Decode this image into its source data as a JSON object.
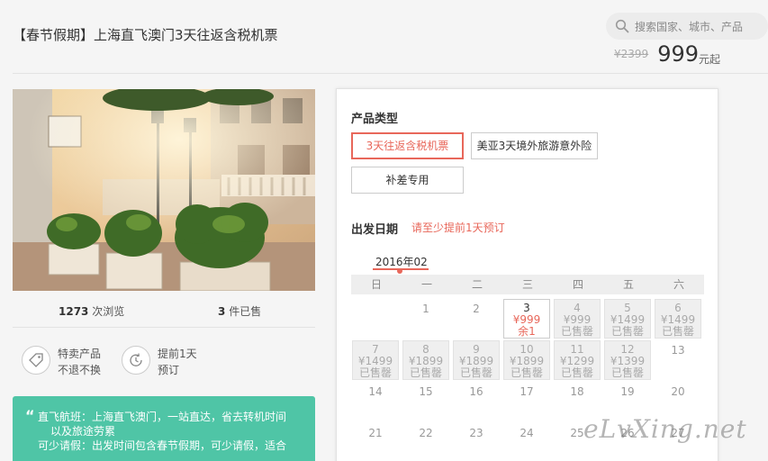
{
  "header": {
    "title": "【春节假期】上海直飞澳门3天往返含税机票",
    "search_placeholder": "搜索国家、城市、产品",
    "old_price": "¥2399",
    "price": "999",
    "price_unit": "元起"
  },
  "stats": {
    "views": "1273",
    "views_label": "次浏览",
    "sold": "3",
    "sold_label": "件已售"
  },
  "features": [
    {
      "icon": "tag-icon",
      "line1": "特卖产品",
      "line2": "不退不换"
    },
    {
      "icon": "clock-icon",
      "line1": "提前1天",
      "line2": "预订"
    }
  ],
  "promo": {
    "line1": "直飞航班：上海直飞澳门，一站直达，省去转机时间",
    "line2": "以及旅途劳累",
    "line3": "可少请假：出发时间包含春节假期，可少请假，适合"
  },
  "booking": {
    "product_type_label": "产品类型",
    "options": [
      "3天往返含税机票",
      "美亚3天境外旅游意外险",
      "补差专用"
    ],
    "date_label": "出发日期",
    "date_note": "请至少提前1天预订",
    "month": "2016年02",
    "weekdays": [
      "日",
      "一",
      "二",
      "三",
      "四",
      "五",
      "六"
    ],
    "days": [
      {
        "day": "1",
        "state": "plain"
      },
      {
        "day": "2",
        "state": "plain"
      },
      {
        "day": "3",
        "state": "avail",
        "price": "¥999",
        "status": "余1"
      },
      {
        "day": "4",
        "state": "sold",
        "price": "¥999",
        "status": "已售罄"
      },
      {
        "day": "5",
        "state": "sold",
        "price": "¥1499",
        "status": "已售罄"
      },
      {
        "day": "6",
        "state": "sold",
        "price": "¥1499",
        "status": "已售罄"
      },
      {
        "day": "7",
        "state": "sold",
        "price": "¥1499",
        "status": "已售罄"
      },
      {
        "day": "8",
        "state": "sold",
        "price": "¥1899",
        "status": "已售罄"
      },
      {
        "day": "9",
        "state": "sold",
        "price": "¥1899",
        "status": "已售罄"
      },
      {
        "day": "10",
        "state": "sold",
        "price": "¥1899",
        "status": "已售罄"
      },
      {
        "day": "11",
        "state": "sold",
        "price": "¥1299",
        "status": "已售罄"
      },
      {
        "day": "12",
        "state": "sold",
        "price": "¥1399",
        "status": "已售罄"
      },
      {
        "day": "13",
        "state": "plain"
      },
      {
        "day": "14",
        "state": "plain"
      },
      {
        "day": "15",
        "state": "plain"
      },
      {
        "day": "16",
        "state": "plain"
      },
      {
        "day": "17",
        "state": "plain"
      },
      {
        "day": "18",
        "state": "plain"
      },
      {
        "day": "19",
        "state": "plain"
      },
      {
        "day": "20",
        "state": "plain"
      },
      {
        "day": "21",
        "state": "plain"
      },
      {
        "day": "22",
        "state": "plain"
      },
      {
        "day": "23",
        "state": "plain"
      },
      {
        "day": "24",
        "state": "plain"
      },
      {
        "day": "25",
        "state": "plain"
      },
      {
        "day": "26",
        "state": "plain"
      },
      {
        "day": "27",
        "state": "plain"
      }
    ]
  },
  "watermark": "eLvXing.net",
  "colors": {
    "accent": "#e8675a",
    "promo_bg": "#4fc5a6"
  }
}
